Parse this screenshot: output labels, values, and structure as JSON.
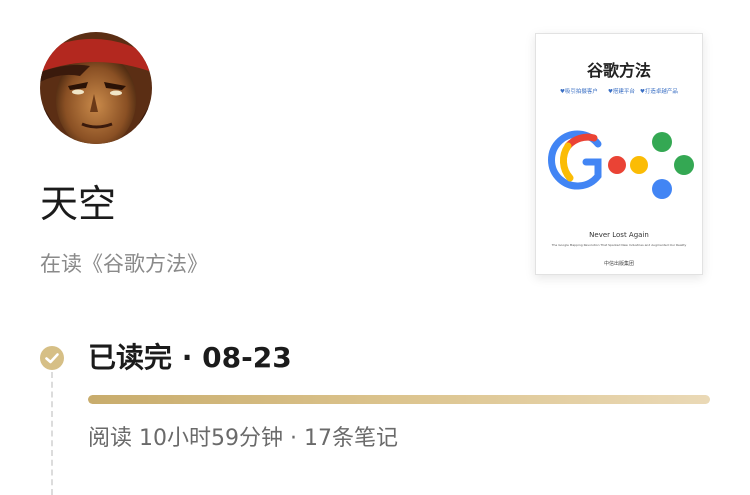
{
  "profile": {
    "username": "天空",
    "reading_prefix": "在读",
    "reading_book": "《谷歌方法》"
  },
  "book": {
    "cover_title": "谷歌方法",
    "cover_tagline_1": "♥吸引拍摄客户",
    "cover_tagline_2": "♥搭建平台",
    "cover_tagline_3": "♥打造卓越产品",
    "cover_english_title": "Never Lost Again",
    "cover_subtitle_en": "The Google Mapping Revolution That Sparked New Industries and Augmented Our Reality",
    "cover_publisher": "中信出版集团",
    "cover_logo_letters": [
      "G",
      "o",
      "o",
      "g",
      "l",
      "e"
    ]
  },
  "timeline": {
    "status_icon": "checkmark-icon",
    "finished_label": "已读完",
    "separator": " · ",
    "finished_date": "08-23",
    "progress": 1.0,
    "stats_time_label": "阅读 10小时59分钟",
    "stats_notes_label": "17条笔记"
  },
  "colors": {
    "accent_gold": "#d6bf86",
    "progress_start": "#c8ac6c",
    "progress_end": "#ead9b6",
    "google_blue": "#4285f4",
    "google_red": "#ea4335",
    "google_yellow": "#fbbc05",
    "google_green": "#34a853"
  }
}
